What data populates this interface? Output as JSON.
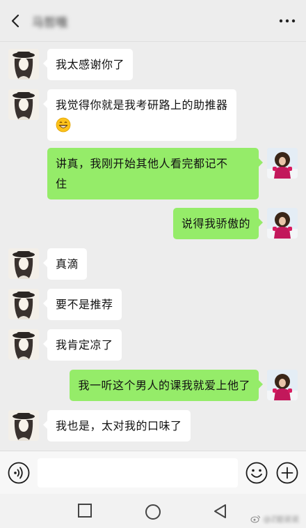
{
  "header": {
    "title": "马哲哦",
    "back_icon": "chevron-left-icon",
    "more_icon": "more-dots-icon"
  },
  "messages": [
    {
      "side": "in",
      "text": "我太感谢你了"
    },
    {
      "side": "in",
      "text": "我觉得你就是我考研路上的助推器"
    },
    {
      "side": "out",
      "line1": "讲真，我刚开始其他人看完都记不",
      "line2": "住"
    },
    {
      "side": "out",
      "text": "说得我骄傲的"
    },
    {
      "side": "in",
      "text": "真滴"
    },
    {
      "side": "in",
      "text": "要不是推荐"
    },
    {
      "side": "in",
      "text": "我肯定凉了"
    },
    {
      "side": "out",
      "text": "我一听这个男人的课我就爱上他了"
    },
    {
      "side": "in",
      "text": "我也是，太对我的口味了"
    }
  ],
  "input": {
    "voice_icon": "voice-icon",
    "emoji_icon": "emoji-icon",
    "plus_icon": "plus-icon",
    "value": ""
  },
  "watermark": {
    "text": "@Z姐说说"
  },
  "colors": {
    "background": "#ededed",
    "incoming_bubble": "#ffffff",
    "outgoing_bubble": "#95ec69"
  }
}
